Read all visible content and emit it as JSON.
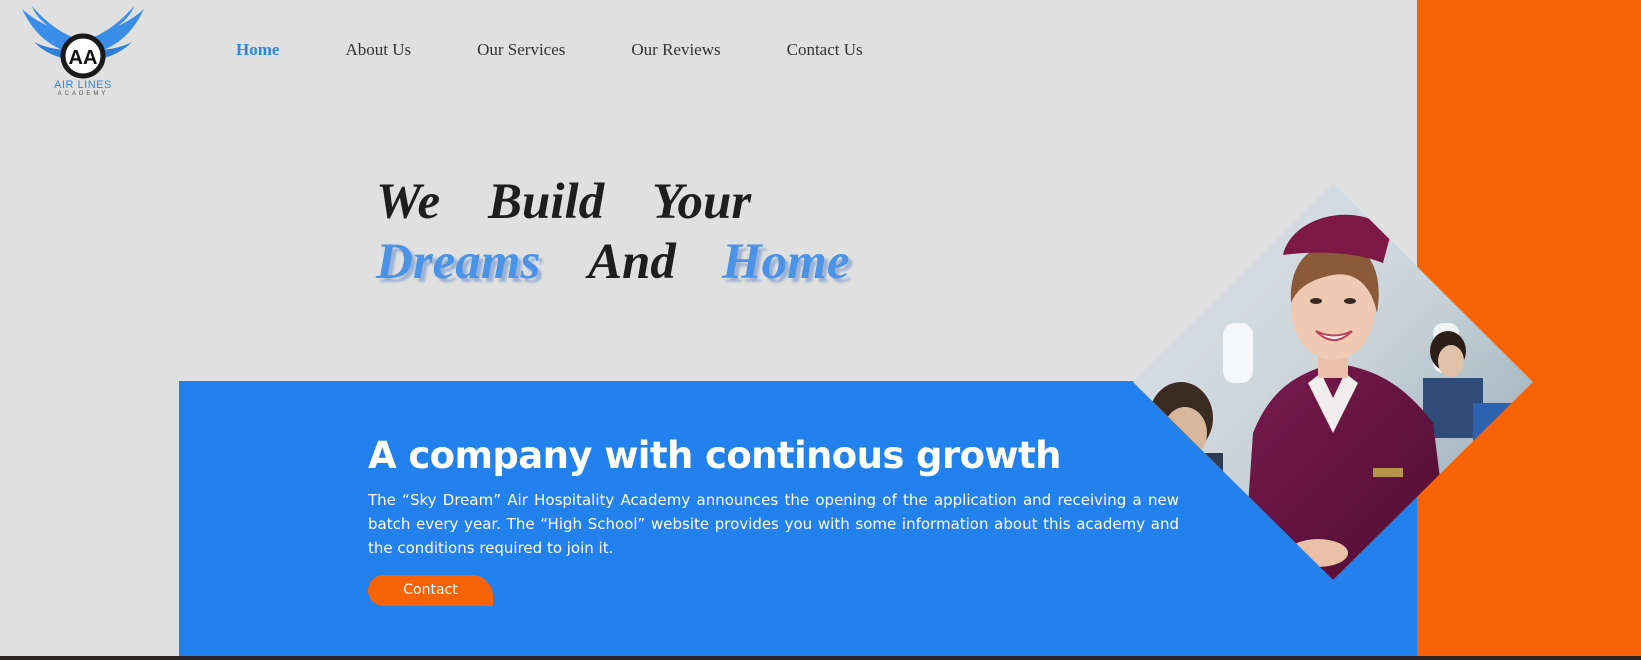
{
  "logo": {
    "monogram": "AA",
    "line1": "AIR LINES",
    "line2": "ACADEMY"
  },
  "nav": {
    "items": [
      {
        "label": "Home",
        "active": true
      },
      {
        "label": "About Us",
        "active": false
      },
      {
        "label": "Our Services",
        "active": false
      },
      {
        "label": "Our Reviews",
        "active": false
      },
      {
        "label": "Contact Us",
        "active": false
      }
    ]
  },
  "hero": {
    "line1": [
      "We",
      "Build",
      "Your"
    ],
    "line2": [
      "Dreams",
      "And",
      "Home"
    ]
  },
  "panel": {
    "title": "A company with continous growth",
    "text": "The “Sky Dream” Air Hospitality Academy announces the opening of the application and receiving a new batch every year. The “High School” website provides you with some information about this academy and the conditions required to join it.",
    "button_label": "Contact"
  },
  "colors": {
    "accent_blue": "#2281ec",
    "accent_orange": "#f86305",
    "background": "#e0e0e0"
  }
}
